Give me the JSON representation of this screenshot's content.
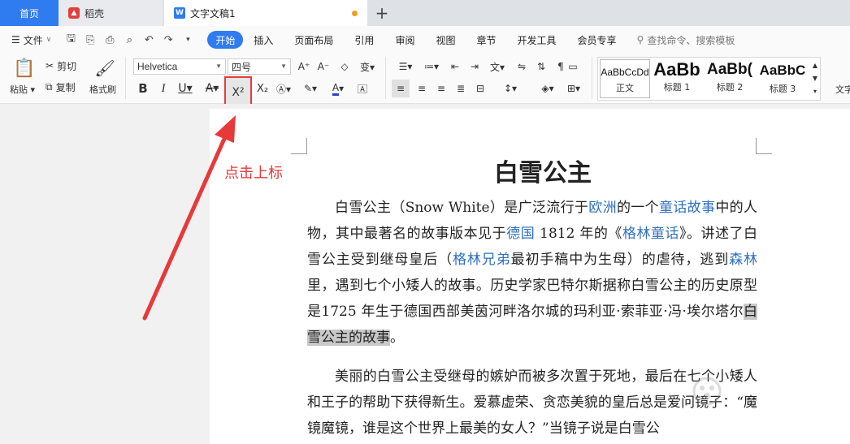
{
  "tabs": {
    "home": "首页",
    "daoke": "稻壳",
    "doc": "文字文稿1",
    "add": "+"
  },
  "menu": {
    "file": "文件",
    "tabs": [
      "开始",
      "插入",
      "页面布局",
      "引用",
      "审阅",
      "视图",
      "章节",
      "开发工具",
      "会员专享"
    ],
    "search": "查找命令、搜索模板"
  },
  "ribbon": {
    "paste": "粘贴",
    "cut": "剪切",
    "copy": "复制",
    "format_painter": "格式刷",
    "font_name": "Helvetica",
    "font_size": "四号",
    "superscript": "X²",
    "subscript": "X₂",
    "styles": [
      {
        "preview": "AaBbCcDd",
        "name": "正文"
      },
      {
        "preview": "AaBb",
        "name": "标题 1"
      },
      {
        "preview": "AaBb(",
        "name": "标题 2"
      },
      {
        "preview": "AaBbC",
        "name": "标题 3"
      }
    ],
    "more": "文字"
  },
  "document": {
    "title": "白雪公主",
    "p1": {
      "a": "白雪公主（Snow White）是广泛流行于",
      "l1": "欧洲",
      "b": "的一个",
      "l2": "童话故事",
      "c": "中的人物，其中最著名的故事版本见于",
      "l3": "德国",
      "d": " 1812 年的《",
      "l4": "格林童话",
      "e": "》。讲述了白雪公主受到继母皇后（",
      "l5": "格林兄弟",
      "f": "最初手稿中为生母）的虐待，逃到",
      "l6": "森林",
      "g": "里，遇到七个小矮人的故事。历史学家巴特尔斯据称白雪公主的历史原型是1725 年生于德国西部美茵河畔洛尔城的玛利亚·索菲亚·冯·埃尔塔尔",
      "hl": "白雪公主的故事",
      "h": "。"
    },
    "p2": "美丽的白雪公主受继母的嫉妒而被多次置于死地，最后在七个小矮人和王子的帮助下获得新生。爱慕虚荣、贪恋美貌的皇后总是爱问镜子：“魔镜魔镜，谁是这个世界上最美的女人？”当镜子说是白雪公"
  },
  "annotation": {
    "text": "点击上标",
    "color": "#e63a3a"
  },
  "colors": {
    "accent": "#2f7bf0",
    "link": "#2f6fbf"
  }
}
